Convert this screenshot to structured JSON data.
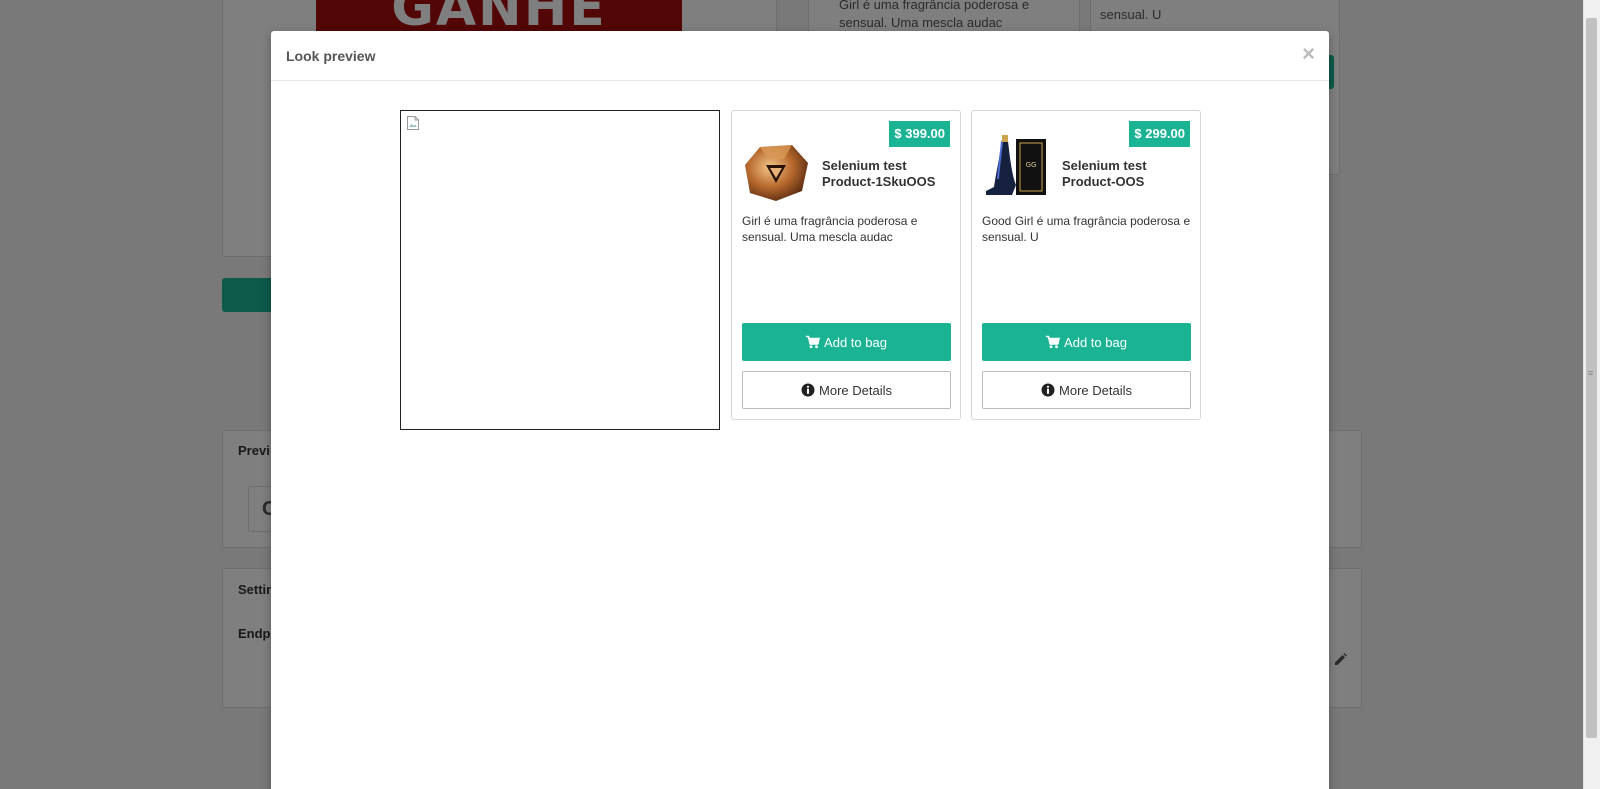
{
  "background": {
    "banner_text": "GANHE",
    "card_text_1": "Girl é uma fragrância poderosa e sensual. Uma mescla audac",
    "card_text_2": "sensual. U",
    "preview_label": "Previ",
    "preview_value": "C",
    "settings_label": "Settin",
    "endpoint_label": "Endpo"
  },
  "modal": {
    "title": "Look preview",
    "close_symbol": "×"
  },
  "look_image": {
    "icon": "broken-image-icon"
  },
  "products": [
    {
      "price": "$ 399.00",
      "name": "Selenium test Product-1SkuOOS",
      "description": "Girl é uma fragrância poderosa e sensual. Uma mescla audac",
      "add_label": "Add to bag",
      "details_label": "More Details",
      "thumb": "perfume-bottle-gold"
    },
    {
      "price": "$ 299.00",
      "name": "Selenium test Product-OOS",
      "description": "Good Girl é uma fragrância poderosa e sensual. U",
      "add_label": "Add to bag",
      "details_label": "More Details",
      "thumb": "perfume-bottle-shoe"
    }
  ],
  "colors": {
    "accent": "#1ab394",
    "banner": "#a40c0c"
  }
}
